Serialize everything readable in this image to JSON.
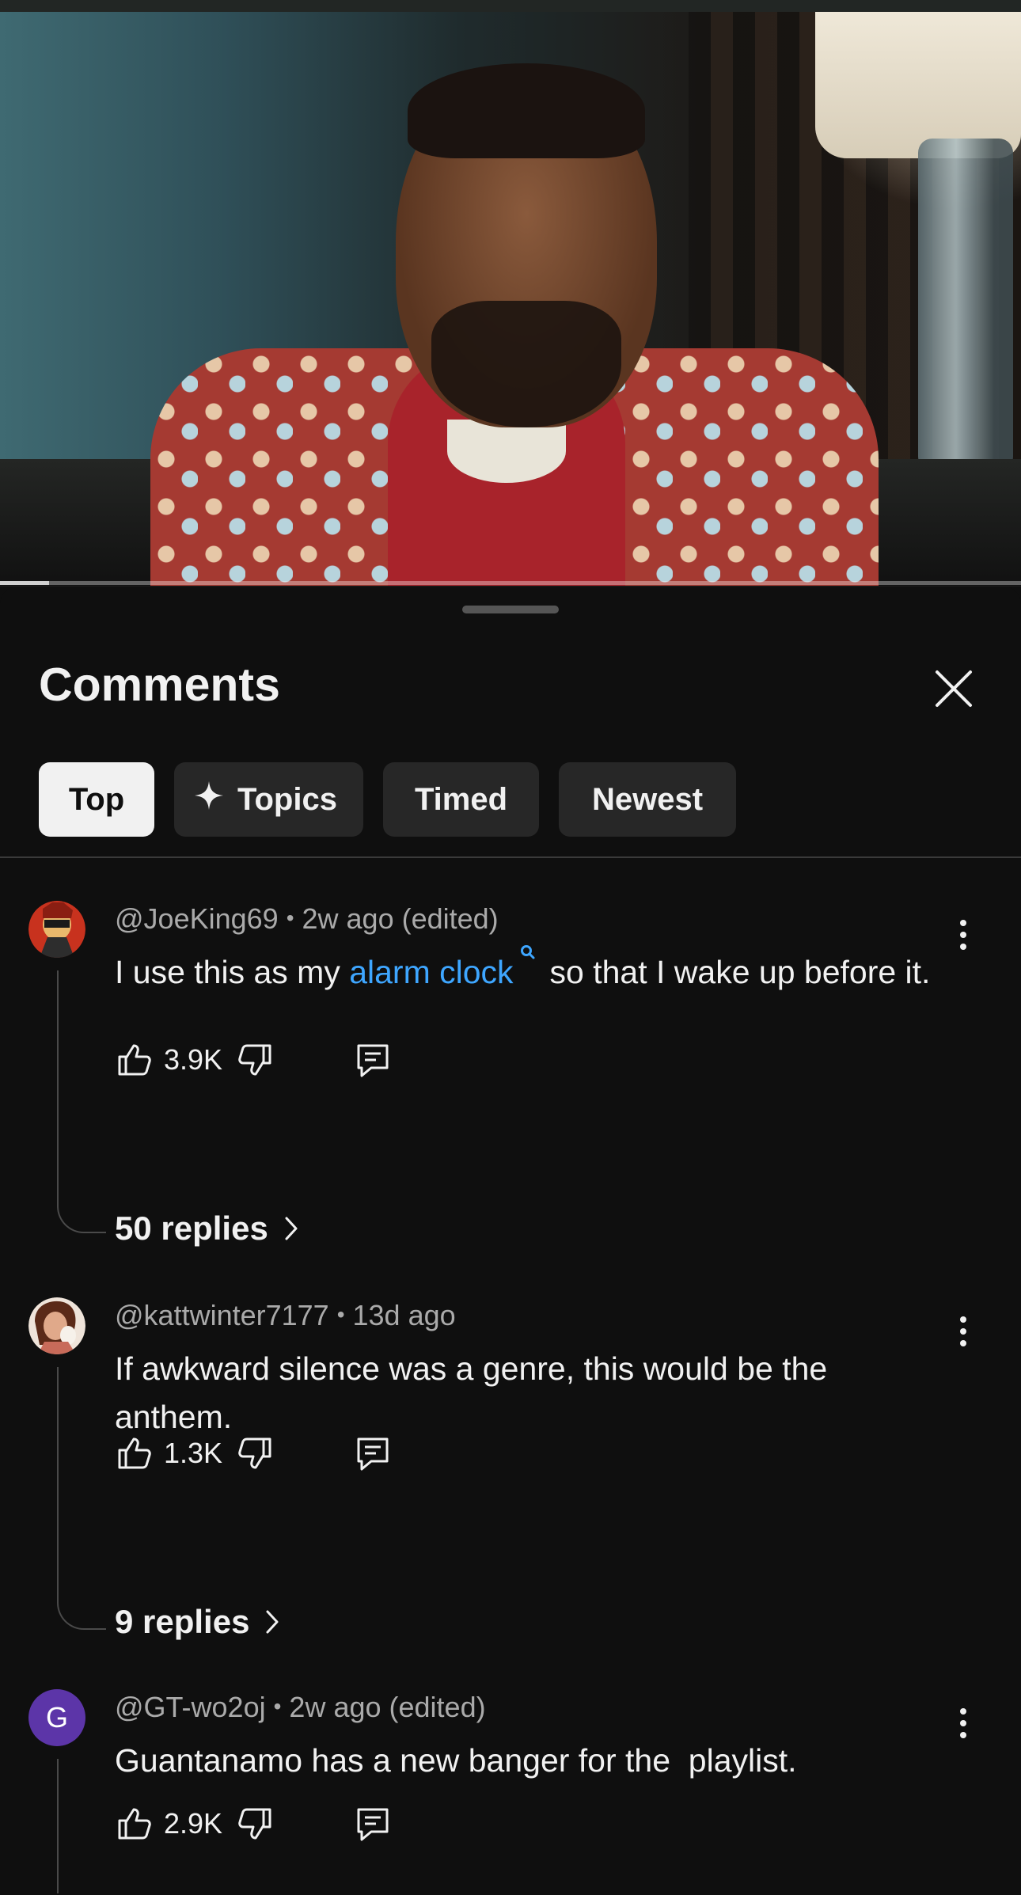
{
  "video": {
    "progress_fraction": 0.048
  },
  "sheet": {
    "title": "Comments",
    "close_icon": "close-icon",
    "chips": [
      {
        "label": "Top",
        "active": true
      },
      {
        "label": "Topics",
        "icon": "sparkle-icon"
      },
      {
        "label": "Timed"
      },
      {
        "label": "Newest"
      }
    ]
  },
  "comments": [
    {
      "handle": "@JoeKing69",
      "time": "2w ago (edited)",
      "text_before": "I use this as my ",
      "link": "alarm clock",
      "text_after": "so that I wake up before it.",
      "likes": "3.9K",
      "replies": "50 replies",
      "avatar_color": "#c8321e"
    },
    {
      "handle": "@kattwinter7177",
      "time": "13d ago",
      "text": "If awkward silence was a genre, this would be the anthem.",
      "likes": "1.3K",
      "replies": "9 replies",
      "avatar_color": "#c86b5a"
    },
    {
      "handle": "@GT-wo2oj",
      "time": "2w ago (edited)",
      "text": "Guantanamo has a new banger for the  playlist.",
      "likes": "2.9K",
      "avatar_letter": "G",
      "avatar_color": "#5c35a8"
    }
  ],
  "colors": {
    "background": "#0f0f0f",
    "link": "#3ea6ff",
    "secondary_text": "#aaaaaa",
    "chip": "#272727"
  }
}
